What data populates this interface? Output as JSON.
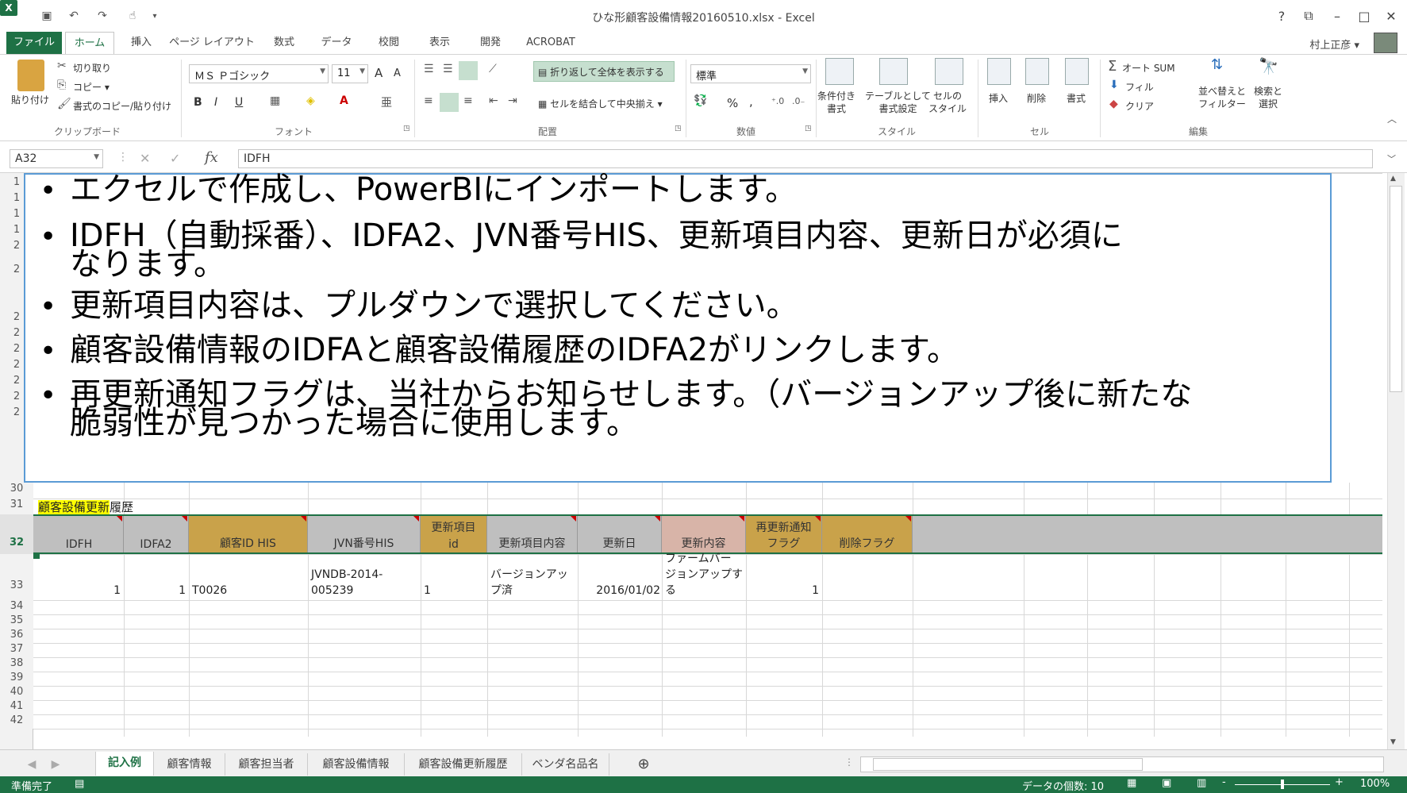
{
  "window": {
    "title": "ひな形顧客設備情報20160510.xlsx - Excel",
    "help": "?",
    "restore": "⧉",
    "minimize": "–",
    "maximize": "□",
    "close": "✕"
  },
  "qat": {
    "logo": "X",
    "save": "💾",
    "undo": "↶",
    "redo": "↷",
    "touch": "☝"
  },
  "tabs": {
    "file": "ファイル",
    "home": "ホーム",
    "insert": "挿入",
    "layout": "ページ レイアウト",
    "formulas": "数式",
    "data": "データ",
    "review": "校閲",
    "view": "表示",
    "dev": "開発",
    "acrobat": "ACROBAT"
  },
  "user": {
    "name": "村上正彦 ▾"
  },
  "ribbon": {
    "clipboard": {
      "paste": "貼り付け",
      "cut": "切り取り",
      "copy": "コピー ▾",
      "painter": "書式のコピー/貼り付け",
      "label": "クリップボード"
    },
    "font": {
      "name": "ＭＳ Ｐゴシック",
      "size": "11",
      "bold": "B",
      "italic": "I",
      "underline": "U",
      "grow": "A",
      "shrink": "A",
      "label": "フォント"
    },
    "align": {
      "wrap": "折り返して全体を表示する",
      "merge": "セルを結合して中央揃え",
      "label": "配置"
    },
    "number": {
      "format": "標準",
      "percent": "%",
      "comma": ",",
      "label": "数値"
    },
    "styles": {
      "cond": "条件付き\n書式",
      "table": "テーブルとして\n書式設定",
      "cell": "セルの\nスタイル",
      "label": "スタイル"
    },
    "cells": {
      "insert": "挿入",
      "delete": "削除",
      "format": "書式",
      "label": "セル"
    },
    "editing": {
      "autosum": "オート SUM",
      "fill": "フィル",
      "clear": "クリア",
      "sort": "並べ替えと\nフィルター",
      "find": "検索と\n選択",
      "label": "編集"
    }
  },
  "formula": {
    "namebox": "A32",
    "cancel": "✕",
    "enter": "✓",
    "fx": "fx",
    "value": "IDFH"
  },
  "rows": {
    "r1": "1",
    "r2": "1",
    "r3": "1",
    "r4": "1",
    "r5": "2",
    "r6": "2",
    "r7": "2",
    "r8": "2",
    "r9": "2",
    "r10": "2",
    "r11": "2",
    "r12": "2",
    "r13": "2",
    "r30": "30",
    "r31": "31",
    "r32": "32",
    "r33": "33",
    "r34": "34",
    "r35": "35",
    "r36": "36",
    "r37": "37",
    "r38": "38",
    "r39": "39",
    "r40": "40",
    "r41": "41",
    "r42": "42"
  },
  "overlay": {
    "l1": "エクセルで作成し、PowerBIにインポートします。",
    "l2a": "IDFH（自動採番）、IDFA2、JVN番号HIS、更新項目内容、更新日が必須に",
    "l2b": "なります。",
    "l3": "更新項目内容は、プルダウンで選択してください。",
    "l4": "顧客設備情報のIDFAと顧客設備履歴のIDFA2がリンクします。",
    "l5a": "再更新通知フラグは、当社からお知らせします。（バージョンアップ後に新たな",
    "l5b": "脆弱性が見つかった場合に使用します。",
    "bullet": "•"
  },
  "table": {
    "title_hl": "顧客設備更新",
    "title_rest": "履歴",
    "headers": {
      "idfh": "IDFH",
      "idfa2": "IDFA2",
      "custid": "顧客ID HIS",
      "jvn": "JVN番号HIS",
      "itemid_a": "更新項目",
      "itemid_b": "id",
      "item": "更新項目内容",
      "date": "更新日",
      "content": "更新内容",
      "reflag_a": "再更新通知",
      "reflag_b": "フラグ",
      "delflag": "削除フラグ"
    },
    "row33": {
      "idfh": "1",
      "idfa2": "1",
      "custid": "T0026",
      "jvn_a": "JVNDB-2014-",
      "jvn_b": "005239",
      "itemid": "1",
      "item_a": "バージョンアッ",
      "item_b": "プ済",
      "date": "2016/01/02",
      "content_a": "ファームバー",
      "content_b": "ジョンアップす",
      "content_c": "る",
      "reflag": "1"
    }
  },
  "sheets": {
    "nav_prev": "◀",
    "nav_next": "▶",
    "s1": "記入例",
    "s2": "顧客情報",
    "s3": "顧客担当者",
    "s4": "顧客設備情報",
    "s5": "顧客設備更新履歴",
    "s6": "ベンダ名品名",
    "add": "⊕"
  },
  "status": {
    "ready": "準備完了",
    "count": "データの個数: 10",
    "zoom": "100%",
    "minus": "-",
    "plus": "+"
  },
  "colors": {
    "accent": "#1e7145",
    "header_gray": "#bfbfbf",
    "header_gold": "#c9a24a",
    "header_pink": "#d8b4a8",
    "title_yellow": "#ffff00",
    "overlay_border": "#5b9bd5"
  }
}
